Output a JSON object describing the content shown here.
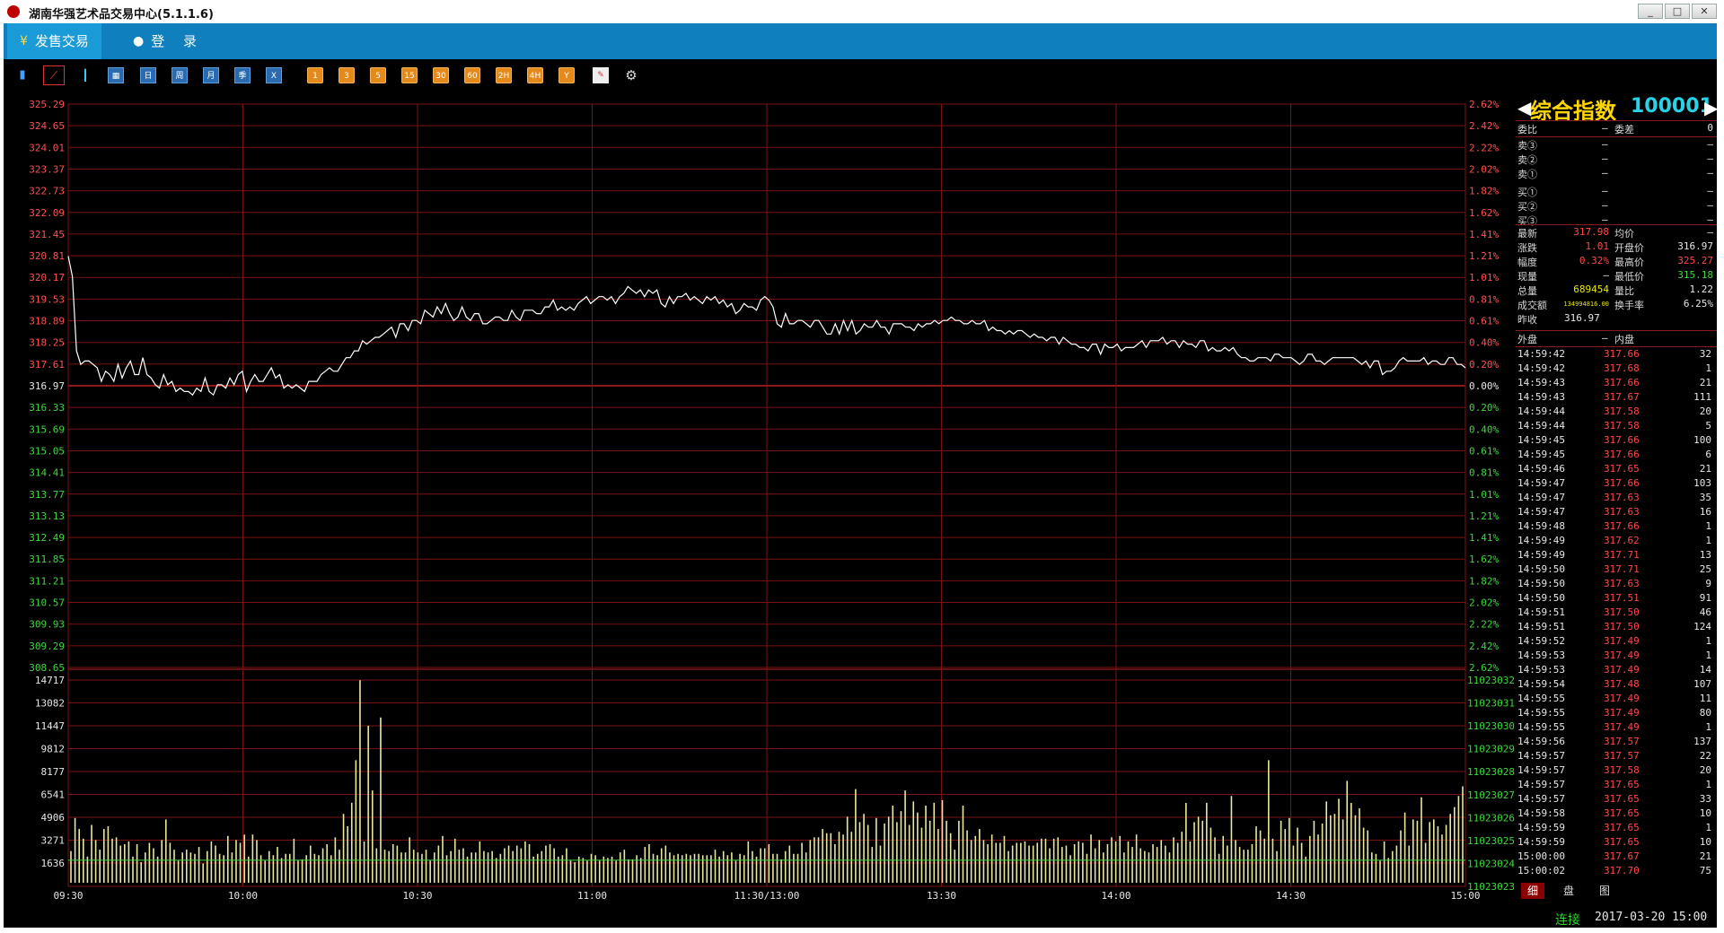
{
  "window": {
    "title": "湖南华强艺术品交易中心(5.1.1.6)",
    "min": "_",
    "max": "□",
    "close": "✕"
  },
  "menu": {
    "sale": "发售交易",
    "login": "登 录"
  },
  "toolbar": {
    "icons": [
      "bar-chart-icon",
      "line-chart-icon",
      "candle-chart-icon",
      "calendar-icon"
    ],
    "periods": [
      "日",
      "周",
      "月",
      "季",
      "X"
    ],
    "minutes": [
      "1",
      "3",
      "5",
      "15",
      "30",
      "60",
      "2H",
      "4H",
      "Y"
    ],
    "tools": [
      "draw-icon",
      "gear-icon"
    ]
  },
  "quote": {
    "name": "综合指数",
    "code": "100001",
    "weibi_label": "委比",
    "weibi": "—",
    "weicha_label": "委差",
    "weicha": "0",
    "sells": [
      {
        "label": "卖③",
        "price": "—",
        "vol": "—"
      },
      {
        "label": "卖②",
        "price": "—",
        "vol": "—"
      },
      {
        "label": "卖①",
        "price": "—",
        "vol": "—"
      }
    ],
    "buys": [
      {
        "label": "买①",
        "price": "—",
        "vol": "—"
      },
      {
        "label": "买②",
        "price": "—",
        "vol": "—"
      },
      {
        "label": "买③",
        "price": "—",
        "vol": "—"
      }
    ],
    "stats": [
      {
        "l1": "最新",
        "v1": "317.98",
        "c1": "red",
        "l2": "均价",
        "v2": "—",
        "c2": "white"
      },
      {
        "l1": "涨跌",
        "v1": "1.01",
        "c1": "red",
        "l2": "开盘价",
        "v2": "316.97",
        "c2": "white"
      },
      {
        "l1": "幅度",
        "v1": "0.32%",
        "c1": "red",
        "l2": "最高价",
        "v2": "325.27",
        "c2": "red"
      },
      {
        "l1": "现量",
        "v1": "—",
        "c1": "white",
        "l2": "最低价",
        "v2": "315.18",
        "c2": "green"
      },
      {
        "l1": "总量",
        "v1": "689454",
        "c1": "yellow",
        "l2": "量比",
        "v2": "1.22",
        "c2": "white"
      },
      {
        "l1": "成交额",
        "v1": "134994816.00",
        "c1": "yellow",
        "l2": "换手率",
        "v2": "6.25%",
        "c2": "white"
      }
    ],
    "prev_label": "昨收",
    "prev": "316.97",
    "waipan_label": "外盘",
    "waipan": "—",
    "neipan_label": "内盘",
    "neipan": "—"
  },
  "ticks": [
    [
      "14:59:42",
      "317.66",
      "32"
    ],
    [
      "14:59:42",
      "317.68",
      "1"
    ],
    [
      "14:59:43",
      "317.66",
      "21"
    ],
    [
      "14:59:43",
      "317.67",
      "111"
    ],
    [
      "14:59:44",
      "317.58",
      "20"
    ],
    [
      "14:59:44",
      "317.58",
      "5"
    ],
    [
      "14:59:45",
      "317.66",
      "100"
    ],
    [
      "14:59:45",
      "317.66",
      "6"
    ],
    [
      "14:59:46",
      "317.65",
      "21"
    ],
    [
      "14:59:47",
      "317.66",
      "103"
    ],
    [
      "14:59:47",
      "317.63",
      "35"
    ],
    [
      "14:59:47",
      "317.63",
      "16"
    ],
    [
      "14:59:48",
      "317.66",
      "1"
    ],
    [
      "14:59:49",
      "317.62",
      "1"
    ],
    [
      "14:59:49",
      "317.71",
      "13"
    ],
    [
      "14:59:50",
      "317.71",
      "25"
    ],
    [
      "14:59:50",
      "317.63",
      "9"
    ],
    [
      "14:59:50",
      "317.51",
      "91"
    ],
    [
      "14:59:51",
      "317.50",
      "46"
    ],
    [
      "14:59:51",
      "317.50",
      "124"
    ],
    [
      "14:59:52",
      "317.49",
      "1"
    ],
    [
      "14:59:53",
      "317.49",
      "1"
    ],
    [
      "14:59:53",
      "317.49",
      "14"
    ],
    [
      "14:59:54",
      "317.48",
      "107"
    ],
    [
      "14:59:55",
      "317.49",
      "11"
    ],
    [
      "14:59:55",
      "317.49",
      "80"
    ],
    [
      "14:59:55",
      "317.49",
      "1"
    ],
    [
      "14:59:56",
      "317.57",
      "137"
    ],
    [
      "14:59:57",
      "317.57",
      "22"
    ],
    [
      "14:59:57",
      "317.58",
      "20"
    ],
    [
      "14:59:57",
      "317.65",
      "1"
    ],
    [
      "14:59:57",
      "317.65",
      "33"
    ],
    [
      "14:59:58",
      "317.65",
      "10"
    ],
    [
      "14:59:59",
      "317.65",
      "1"
    ],
    [
      "14:59:59",
      "317.65",
      "10"
    ],
    [
      "15:00:00",
      "317.67",
      "21"
    ],
    [
      "15:00:02",
      "317.70",
      "75"
    ]
  ],
  "tabs": [
    "细",
    "盘",
    "图"
  ],
  "status": {
    "conn": "连接",
    "datetime": "2017-03-20 15:00"
  },
  "chart_data": {
    "type": "line",
    "price_ticks": [
      "325.29",
      "324.65",
      "324.01",
      "323.37",
      "322.73",
      "322.09",
      "321.45",
      "320.81",
      "320.17",
      "319.53",
      "318.89",
      "318.25",
      "317.61",
      "316.97",
      "316.33",
      "315.69",
      "315.05",
      "314.41",
      "313.77",
      "313.13",
      "312.49",
      "311.85",
      "311.21",
      "310.57",
      "309.93",
      "309.29",
      "308.65"
    ],
    "pct_ticks": [
      "2.62%",
      "2.42%",
      "2.22%",
      "2.02%",
      "1.82%",
      "1.62%",
      "1.41%",
      "1.21%",
      "1.01%",
      "0.81%",
      "0.61%",
      "0.40%",
      "0.20%",
      "0.00%",
      "0.20%",
      "0.40%",
      "0.61%",
      "0.81%",
      "1.01%",
      "1.21%",
      "1.41%",
      "1.62%",
      "1.82%",
      "2.02%",
      "2.22%",
      "2.42%",
      "2.62%"
    ],
    "vol_ticks": [
      "14717",
      "13082",
      "11447",
      "9812",
      "8177",
      "6541",
      "4906",
      "3271",
      "1636"
    ],
    "right_vol_ticks": [
      "11023032",
      "11023031",
      "11023030",
      "11023029",
      "11023028",
      "11023027",
      "11023026",
      "11023025",
      "11023024",
      "11023023"
    ],
    "time_ticks": [
      "09:30",
      "10:00",
      "10:30",
      "11:00",
      "11:30/13:00",
      "13:30",
      "14:00",
      "14:30",
      "15:00"
    ],
    "prev_close": 316.97,
    "ylim": [
      308.65,
      325.29
    ],
    "vol_max": 14717,
    "price": [
      320.8,
      320.2,
      318.0,
      317.6,
      317.7,
      317.7,
      317.6,
      317.5,
      317.1,
      317.4,
      317.3,
      317.1,
      317.6,
      317.2,
      317.5,
      317.7,
      317.3,
      317.3,
      317.8,
      317.3,
      317.2,
      317.0,
      316.9,
      317.3,
      317.0,
      317.1,
      316.8,
      316.9,
      316.8,
      316.8,
      316.7,
      316.9,
      316.8,
      317.2,
      316.8,
      316.7,
      317.0,
      317.0,
      316.9,
      317.2,
      317.0,
      317.3,
      317.4,
      316.8,
      317.1,
      317.3,
      317.1,
      317.1,
      317.3,
      317.5,
      317.2,
      317.3,
      316.9,
      317.0,
      316.9,
      317.0,
      316.9,
      316.8,
      317.1,
      317.1,
      317.1,
      317.3,
      317.4,
      317.5,
      317.4,
      317.4,
      317.6,
      317.8,
      317.8,
      318.0,
      318.0,
      318.3,
      318.2,
      318.3,
      318.4,
      318.4,
      318.5,
      318.6,
      318.7,
      318.4,
      318.8,
      318.8,
      318.6,
      318.9,
      318.9,
      318.8,
      319.2,
      319.1,
      319.0,
      319.3,
      319.1,
      319.4,
      319.1,
      318.9,
      319.0,
      319.3,
      319.0,
      318.9,
      319.1,
      319.1,
      318.8,
      318.8,
      318.9,
      319.0,
      319.0,
      318.9,
      318.9,
      319.2,
      319.0,
      318.9,
      319.2,
      319.2,
      319.2,
      319.1,
      319.1,
      319.3,
      319.3,
      319.5,
      319.2,
      319.3,
      319.2,
      319.3,
      319.2,
      319.4,
      319.5,
      319.6,
      319.4,
      319.5,
      319.6,
      319.6,
      319.5,
      319.6,
      319.4,
      319.6,
      319.7,
      319.9,
      319.8,
      319.7,
      319.8,
      319.6,
      319.8,
      319.7,
      319.8,
      319.4,
      319.3,
      319.6,
      319.4,
      319.6,
      319.6,
      319.7,
      319.5,
      319.6,
      319.5,
      319.4,
      319.6,
      319.5,
      319.6,
      319.4,
      319.5,
      319.3,
      319.4,
      319.1,
      319.2,
      319.4,
      319.3,
      319.3,
      319.2,
      319.5,
      319.6,
      319.5,
      319.3,
      318.8,
      318.7,
      319.1,
      318.8,
      318.8,
      318.9,
      318.9,
      318.8,
      318.7,
      318.9,
      318.9,
      318.7,
      318.5,
      318.5,
      318.8,
      318.5,
      318.9,
      318.6,
      318.9,
      318.5,
      318.6,
      318.8,
      318.7,
      318.7,
      318.9,
      318.7,
      318.7,
      318.5,
      318.8,
      318.8,
      318.8,
      318.7,
      318.7,
      318.6,
      318.8,
      318.7,
      318.8,
      318.8,
      318.9,
      318.8,
      318.9,
      318.9,
      319.0,
      318.9,
      318.9,
      318.8,
      318.8,
      318.9,
      318.8,
      318.8,
      318.9,
      318.6,
      318.7,
      318.6,
      318.6,
      318.5,
      318.6,
      318.5,
      318.6,
      318.6,
      318.5,
      318.4,
      318.5,
      318.4,
      318.4,
      318.3,
      318.4,
      318.4,
      318.2,
      318.4,
      318.3,
      318.2,
      318.2,
      318.1,
      318.1,
      318.0,
      318.2,
      318.2,
      317.9,
      318.2,
      318.1,
      318.1,
      318.2,
      318.0,
      318.1,
      318.1,
      318.1,
      318.2,
      318.3,
      318.1,
      318.3,
      318.3,
      318.3,
      318.4,
      318.2,
      318.3,
      318.3,
      318.1,
      318.3,
      318.2,
      318.2,
      318.1,
      318.3,
      318.3,
      318.0,
      318.1,
      318.0,
      318.0,
      318.1,
      318.0,
      318.1,
      317.9,
      317.8,
      317.8,
      317.7,
      317.7,
      317.8,
      317.8,
      317.8,
      317.7,
      317.9,
      317.9,
      317.8,
      317.8,
      317.8,
      317.7,
      317.6,
      317.7,
      317.9,
      317.9,
      317.7,
      317.7,
      317.6,
      317.7,
      317.8,
      317.8,
      317.8,
      317.8,
      317.8,
      317.8,
      317.7,
      317.6,
      317.7,
      317.5,
      317.7,
      317.7,
      317.3,
      317.4,
      317.4,
      317.5,
      317.7,
      317.8,
      317.7,
      317.7,
      317.7,
      317.7,
      317.8,
      317.6,
      317.7,
      317.7,
      317.6,
      317.6,
      317.8,
      317.8,
      317.6,
      317.6,
      317.5
    ],
    "volume": [
      2300,
      4700,
      3900,
      3200,
      1900,
      4200,
      3100,
      2400,
      3900,
      4100,
      3200,
      3300,
      2700,
      2800,
      3000,
      1900,
      2800,
      1500,
      2200,
      2900,
      2500,
      1900,
      3100,
      4600,
      2900,
      2400,
      1600,
      2200,
      2400,
      2200,
      2100,
      2600,
      1400,
      2300,
      3000,
      2700,
      2100,
      2000,
      3400,
      2200,
      3100,
      2900,
      3500,
      1900,
      3500,
      3100,
      2000,
      1600,
      2300,
      2000,
      2600,
      1800,
      2100,
      2100,
      3200,
      1600,
      1700,
      2000,
      2700,
      2100,
      2000,
      2500,
      2800,
      2000,
      3300,
      2400,
      5000,
      4100,
      5800,
      8900,
      14700,
      3000,
      11400,
      6700,
      2500,
      12000,
      2400,
      2300,
      2800,
      2700,
      2200,
      2200,
      3300,
      2400,
      2200,
      2100,
      2400,
      1600,
      2200,
      2700,
      3400,
      2000,
      2300,
      3200,
      2400,
      2500,
      1900,
      2200,
      2200,
      3000,
      2300,
      2200,
      2300,
      1800,
      2100,
      2500,
      2700,
      2300,
      2700,
      2500,
      3000,
      2800,
      1900,
      2100,
      2300,
      2700,
      2800,
      2500,
      1900,
      2000,
      2500,
      1600,
      1500,
      1900,
      1800,
      1600,
      2100,
      2000,
      1600,
      1900,
      1800,
      1900,
      1600,
      2200,
      2400,
      1700,
      1700,
      2000,
      1800,
      2600,
      2800,
      2100,
      2000,
      2500,
      2700,
      2200,
      2000,
      2100,
      2000,
      2100,
      2000,
      2100,
      2100,
      2000,
      2000,
      2000,
      2400,
      1900,
      2300,
      2000,
      2200,
      1600,
      2100,
      2000,
      3000,
      2300,
      1900,
      2500,
      2500,
      2800,
      2100,
      2100,
      1700,
      2300,
      2700,
      2100,
      2100,
      2900,
      2200,
      3100,
      3300,
      3300,
      3900,
      3600,
      3600,
      2800,
      3700,
      3500,
      4800,
      3700,
      6800,
      4400,
      5000,
      4200,
      2600,
      4700,
      2700,
      4300,
      4800,
      5600,
      4400,
      5200,
      6700,
      4200,
      5900,
      5100,
      4000,
      5600,
      4500,
      5800,
      3900,
      6000,
      4500,
      3600,
      2400,
      4500,
      5600,
      3800,
      3100,
      3400,
      3900,
      3100,
      2800,
      3500,
      2900,
      2900,
      3400,
      2300,
      2700,
      2900,
      2900,
      3000,
      2700,
      2700,
      2900,
      3200,
      3200,
      2500,
      3200,
      3300,
      2600,
      2700,
      2000,
      2800,
      3000,
      2900,
      2100,
      3500,
      2500,
      3100,
      2200,
      2800,
      3300,
      3000,
      3400,
      2200,
      3000,
      2600,
      3500,
      2500,
      2300,
      2200,
      2800,
      2600,
      3100,
      2700,
      2200,
      3300,
      2900,
      3700,
      5800,
      3000,
      4400,
      4800,
      4500,
      5800,
      4000,
      3300,
      2100,
      3400,
      2700,
      6300,
      3100,
      2600,
      2400,
      2400,
      2800,
      4100,
      3800,
      3200,
      8900,
      3200,
      2300,
      4500,
      3900,
      4700,
      2700,
      4000,
      2900,
      1900,
      3400,
      4500,
      3500,
      4300,
      5900,
      4900,
      5000,
      6100,
      4600,
      7400,
      5800,
      4900,
      5400,
      4000,
      3800,
      2200,
      2100,
      1600,
      3000,
      1800,
      2300,
      2700,
      3800,
      5100,
      2700,
      4600,
      4500,
      6200,
      2900,
      4400,
      4600,
      4100,
      3500,
      4200,
      5000,
      5500,
      6300,
      7000
    ]
  }
}
